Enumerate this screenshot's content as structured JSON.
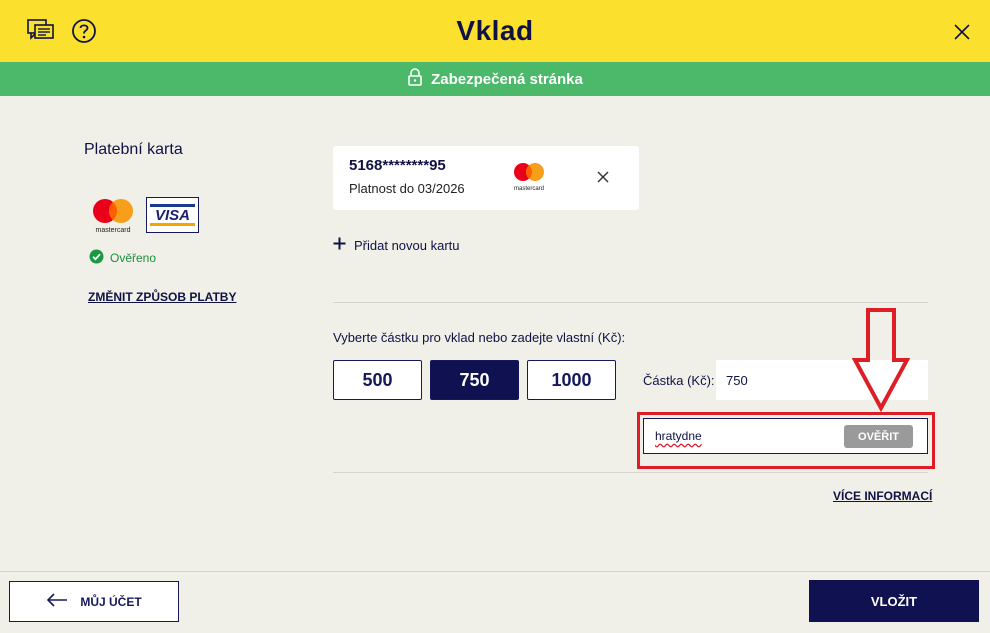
{
  "header": {
    "title": "Vklad",
    "chat_icon": "chat-bubbles-icon",
    "help_icon": "question-circle-icon",
    "close_icon": "close-icon"
  },
  "security": {
    "label": "Zabezpečená stránka",
    "icon": "lock-icon"
  },
  "payment_method": {
    "title": "Platební karta",
    "brands": [
      "mastercard",
      "VISA"
    ],
    "verified_label": "Ověřeno",
    "change_link": "ZMĚNIT ZPŮSOB PLATBY"
  },
  "saved_card": {
    "number": "5168********95",
    "expiry": "Platnost do 03/2026",
    "brand": "mastercard"
  },
  "add_card_label": "Přidat novou kartu",
  "amount": {
    "prompt": "Vyberte částku pro vklad nebo zadejte vlastní (Kč):",
    "presets": [
      "500",
      "750",
      "1000"
    ],
    "selected": "750",
    "custom_label": "Částka (Kč):",
    "custom_value": "750"
  },
  "promo": {
    "value": "hratydne",
    "verify_label": "OVĚŘIT"
  },
  "more_info_link": "VÍCE INFORMACÍ",
  "footer": {
    "back_label": "MŮJ ÚČET",
    "deposit_label": "VLOŽIT"
  },
  "colors": {
    "header_bg": "#fbe02e",
    "secure_bg": "#4cb86a",
    "primary": "#0f1150",
    "highlight": "#dd1e26"
  }
}
